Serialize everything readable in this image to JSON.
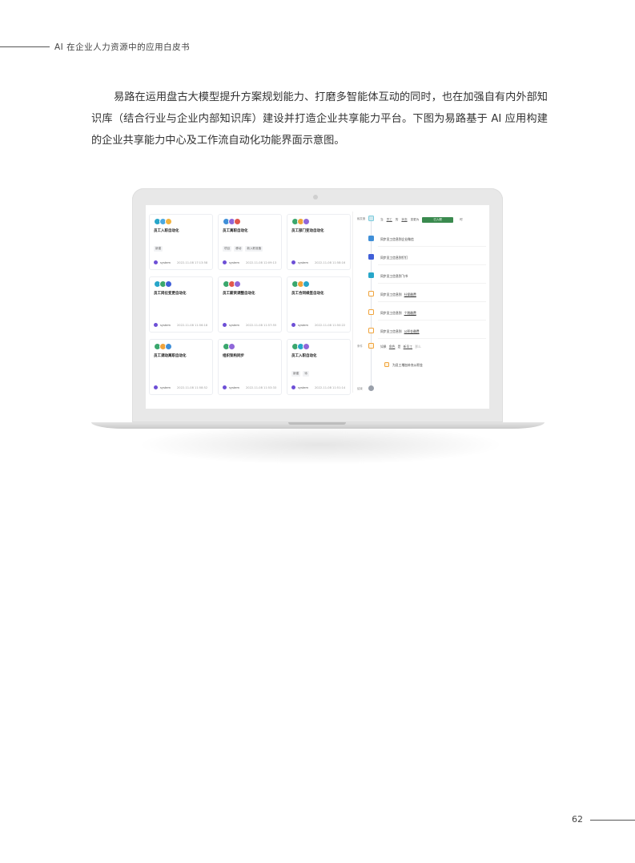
{
  "header": {
    "title": "AI 在企业人力资源中的应用白皮书"
  },
  "body_text": "易路在运用盘古大模型提升方案规划能力、打磨多智能体互动的同时，也在加强自有内外部知识库（结合行业与企业内部知识库）建设并打造企业共享能力平台。下图为易路基于 AI 应用构建的企业共享能力中心及工作流自动化功能界面示意图。",
  "screen": {
    "cards": [
      {
        "title": "员工入职自动化",
        "dots": [
          "#27a6c9",
          "#4aa8e0",
          "#f2b33d"
        ],
        "tags": [
          "新建"
        ],
        "user": "system",
        "time": "2022-11-08 17:13:58"
      },
      {
        "title": "员工离职自动化",
        "dots": [
          "#3f8fd8",
          "#8f67d9",
          "#e2574c"
        ],
        "tags": [
          "项目",
          "移动",
          "新入职准备"
        ],
        "user": "system",
        "time": "2022-11-08 12:09:13"
      },
      {
        "title": "员工部门变动自动化",
        "dots": [
          "#3aa76d",
          "#f0a33b",
          "#8f67d9"
        ],
        "tags": [],
        "user": "system",
        "time": "2022-11-08 11:58:16"
      },
      {
        "title": "员工岗位变更自动化",
        "dots": [
          "#27a6c9",
          "#3aa76d",
          "#3f5fd8"
        ],
        "tags": [],
        "user": "system",
        "time": "2022-11-08 11:56:18"
      },
      {
        "title": "员工薪资调整自动化",
        "dots": [
          "#3aa76d",
          "#e2574c",
          "#8f67d9"
        ],
        "tags": [],
        "user": "system",
        "time": "2022-11-08 11:57:55"
      },
      {
        "title": "员工合同续签自动化",
        "dots": [
          "#3aa76d",
          "#f0a33b",
          "#27a6c9"
        ],
        "tags": [],
        "user": "system",
        "time": "2022-11-08 11:50:22"
      },
      {
        "title": "员工调动离职自动化",
        "dots": [
          "#3aa76d",
          "#f0a33b",
          "#3f8fd8"
        ],
        "tags": [],
        "user": "system",
        "time": "2022-11-08 11:58:52"
      },
      {
        "title": "组织架构同步",
        "dots": [
          "#3aa76d",
          "#8f67d9"
        ],
        "tags": [],
        "user": "system",
        "time": "2022-11-08 11:53:33"
      },
      {
        "title": "员工入职自动化",
        "dots": [
          "#3aa76d",
          "#27a6c9",
          "#8f67d9"
        ],
        "tags": [
          "新建",
          "待"
        ],
        "user": "system",
        "time": "2022-11-08 11:51:14"
      }
    ],
    "flow": {
      "trigger_label": "触发器",
      "condition": {
        "prefix": "当",
        "field": "员工",
        "op": "的",
        "value": "状态",
        "verb": "变更为",
        "button": "已入职",
        "suffix": "时"
      },
      "steps": [
        {
          "text": "同步员工信息到企业微信",
          "link": "",
          "color": "#3f8fd8"
        },
        {
          "text": "同步员工信息到钉钉",
          "link": "",
          "color": "#3f5fd8"
        },
        {
          "text": "同步员工信息到飞书",
          "link": "",
          "color": "#27a6c9"
        },
        {
          "text": "同步员工信息到",
          "link": "社保缴费",
          "color": "#f0a33b"
        },
        {
          "text": "同步员工信息到",
          "link": "个税缴费",
          "color": "#f0a33b"
        },
        {
          "text": "同步员工信息到",
          "link": "公积金缴费",
          "color": "#f0a33b"
        }
      ],
      "branch_label": "条件",
      "branch": {
        "prefix": "如果",
        "field": "角色",
        "op": "是",
        "value": "新员工",
        "suffix": "那么"
      },
      "branch_action": "为员工增加补充公积金",
      "end_label": "结束"
    }
  },
  "footer": {
    "page_number": "62"
  }
}
